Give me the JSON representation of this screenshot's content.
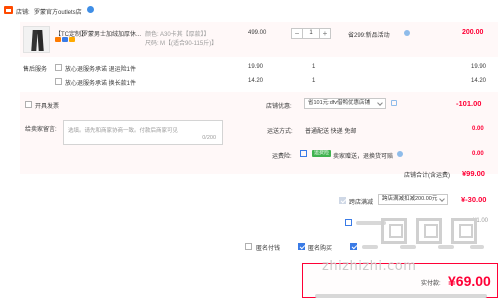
{
  "shop": {
    "label": "店铺:",
    "name": "罗蒙官方outlets店"
  },
  "item": {
    "tag": "【TC定制】",
    "title": "罗蒙男士加绒加厚休...",
    "color_label": "颜色:",
    "color_value": "A30卡其【厚款】】",
    "size_label": "尺码:",
    "size_value": "M【(适合90-115斤)】",
    "price": "499.00",
    "qty": "1",
    "qty_minus": "−",
    "qty_plus": "+",
    "promo": "省299:新品活动",
    "subtotal": "200.00"
  },
  "services": {
    "label": "售后服务",
    "options": [
      {
        "label": "放心退服务承诺 退运险1件",
        "price": "19.90",
        "qty": "1",
        "subtotal": "19.90"
      },
      {
        "label": "放心退服务承诺 换长款1件",
        "price": "14.20",
        "qty": "1",
        "subtotal": "14.20"
      }
    ]
  },
  "invoice": {
    "label": "开具发票"
  },
  "coupon": {
    "label": "店铺优惠:",
    "value": "省101元:dfv借鸭优惠店铺",
    "discount": "-101.00"
  },
  "message": {
    "label": "给卖家留言:",
    "placeholder": "选填。请先和商家协商一致。付款后商家可见",
    "counter": "0/200"
  },
  "shipping": {
    "label": "运送方式:",
    "value": "普通配送 快递 免邮",
    "fee": "0.00"
  },
  "freight": {
    "label": "运费险:",
    "tag": "运费险",
    "value": "卖家赠送，退换货可赔",
    "fee": "0.00"
  },
  "shop_total": {
    "label": "店铺合计(含运费)",
    "value": "¥99.00"
  },
  "cross_store": {
    "label": "跨店满减",
    "select": "跨店满减扣减200.00元",
    "discount": "¥-30.00"
  },
  "extra_row": {
    "value": "¥1.00"
  },
  "options_row": {
    "anon": "匿名付钱",
    "real_name": "匿名购买"
  },
  "total": {
    "label": "实付款:",
    "value": "¥69.00"
  },
  "watermark": "zhizhizhi.com",
  "colors": {
    "accent": "#ff0036",
    "blue": "#3a7be6",
    "green": "#3fb34f"
  }
}
